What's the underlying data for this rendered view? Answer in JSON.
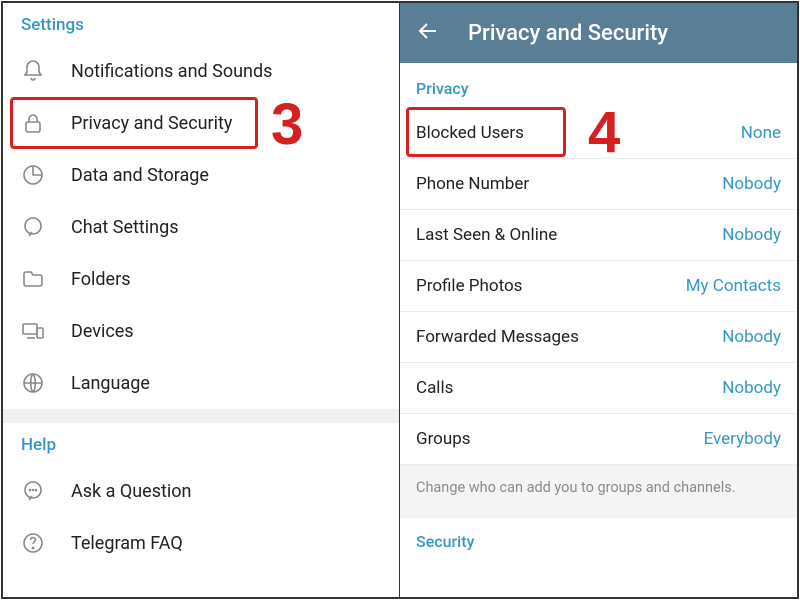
{
  "left": {
    "settings_title": "Settings",
    "help_title": "Help",
    "items": [
      {
        "label": "Notifications and Sounds",
        "icon": "bell"
      },
      {
        "label": "Privacy and Security",
        "icon": "lock"
      },
      {
        "label": "Data and Storage",
        "icon": "chart"
      },
      {
        "label": "Chat Settings",
        "icon": "chat"
      },
      {
        "label": "Folders",
        "icon": "folder"
      },
      {
        "label": "Devices",
        "icon": "devices"
      },
      {
        "label": "Language",
        "icon": "globe"
      }
    ],
    "help_items": [
      {
        "label": "Ask a Question",
        "icon": "question"
      },
      {
        "label": "Telegram FAQ",
        "icon": "faq"
      }
    ]
  },
  "right": {
    "appbar_title": "Privacy and Security",
    "privacy_title": "Privacy",
    "security_title": "Security",
    "privacy_items": [
      {
        "label": "Blocked Users",
        "value": "None"
      },
      {
        "label": "Phone Number",
        "value": "Nobody"
      },
      {
        "label": "Last Seen & Online",
        "value": "Nobody"
      },
      {
        "label": "Profile Photos",
        "value": "My Contacts"
      },
      {
        "label": "Forwarded Messages",
        "value": "Nobody"
      },
      {
        "label": "Calls",
        "value": "Nobody"
      },
      {
        "label": "Groups",
        "value": "Everybody"
      }
    ],
    "help_text": "Change who can add you to groups and channels."
  },
  "callouts": {
    "step3": "3",
    "step4": "4"
  }
}
